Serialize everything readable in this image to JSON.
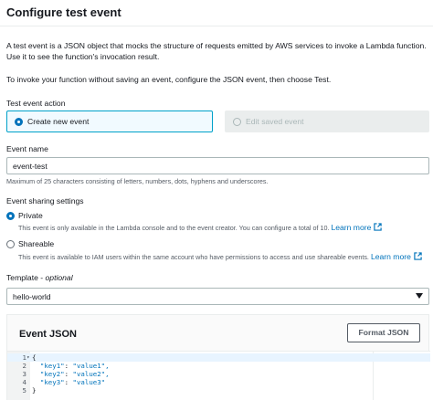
{
  "header": {
    "title": "Configure test event"
  },
  "intro": {
    "description": "A test event is a JSON object that mocks the structure of requests emitted by AWS services to invoke a Lambda function. Use it to see the function's invocation result.",
    "instructions": "To invoke your function without saving an event, configure the JSON event, then choose Test."
  },
  "test_event_action": {
    "label": "Test event action",
    "options": [
      {
        "label": "Create new event",
        "selected": true,
        "disabled": false
      },
      {
        "label": "Edit saved event",
        "selected": false,
        "disabled": true
      }
    ]
  },
  "event_name": {
    "label": "Event name",
    "value": "event-test",
    "hint": "Maximum of 25 characters consisting of letters, numbers, dots, hyphens and underscores."
  },
  "sharing": {
    "label": "Event sharing settings",
    "options": [
      {
        "label": "Private",
        "selected": true,
        "description": "This event is only available in the Lambda console and to the event creator. You can configure a total of 10.",
        "link": "Learn more"
      },
      {
        "label": "Shareable",
        "selected": false,
        "description": "This event is available to IAM users within the same account who have permissions to access and use shareable events.",
        "link": "Learn more"
      }
    ]
  },
  "template": {
    "label": "Template",
    "optional": "optional",
    "separator": " - ",
    "value": "hello-world"
  },
  "event_json": {
    "title": "Event JSON",
    "format_button": "Format JSON",
    "lines": [
      {
        "n": "1",
        "text": "{"
      },
      {
        "n": "2",
        "key": "\"key1\"",
        "value": "\"value1\","
      },
      {
        "n": "3",
        "key": "\"key2\"",
        "value": "\"value2\","
      },
      {
        "n": "4",
        "key": "\"key3\"",
        "value": "\"value3\""
      },
      {
        "n": "5",
        "text": "}"
      }
    ]
  },
  "colors": {
    "accent": "#0073bb",
    "selected_tile_bg": "#f1faff",
    "selected_tile_border": "#00a1c9",
    "disabled_bg": "#eaeded"
  },
  "icons": [
    "radio-checked",
    "radio-unchecked",
    "external-link-icon",
    "chevron-down-icon",
    "fold-arrow-icon"
  ]
}
